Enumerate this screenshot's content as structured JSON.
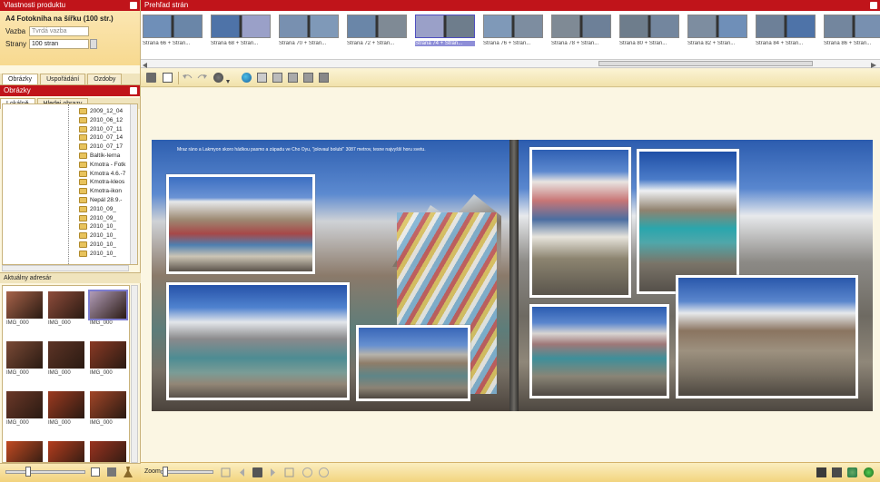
{
  "product_panel": {
    "title": "Vlastnosti produktu",
    "product_name": "A4 Fotokniha na šířku (100 str.)",
    "cover_label": "Vazba",
    "cover_value": "Tvrdá vazba",
    "pages_label": "Strany",
    "pages_value": "100 stran"
  },
  "left_tabs": [
    "Obrázky",
    "Uspořádání",
    "Ozdoby"
  ],
  "images_panel": {
    "title": "Obrázky",
    "tree_tabs": [
      "Lokálně",
      "Hledej obrazy"
    ],
    "folders": [
      "2009_12_04",
      "2010_06_12",
      "2010_07_11",
      "2010_07_14",
      "2010_07_17",
      "Baltík-Ierna",
      "Kmotra - Fotk",
      "Kmotra 4.6.-7",
      "Kmotra-kleos",
      "Kmotra-ikon",
      "Nepál 28.9.-",
      "2010_09_",
      "2010_09_",
      "2010_10_",
      "2010_10_",
      "2010_10_",
      "2010_10_"
    ]
  },
  "recent": {
    "title": "Aktuálny adresár",
    "items": [
      {
        "label": "IMG_000",
        "color": "#a7634a"
      },
      {
        "label": "IMG_000",
        "color": "#8e4c3b"
      },
      {
        "label": "IMG_000",
        "color": "#b19cb8"
      },
      {
        "label": "IMG_000",
        "color": "#7a4a36"
      },
      {
        "label": "IMG_000",
        "color": "#5d3426"
      },
      {
        "label": "IMG_000",
        "color": "#8a3a25"
      },
      {
        "label": "IMG_000",
        "color": "#6b3828"
      },
      {
        "label": "IMG_000",
        "color": "#9c3a20"
      },
      {
        "label": "IMG_000",
        "color": "#a24628"
      },
      {
        "label": "IMG_000",
        "color": "#c24a22"
      },
      {
        "label": "IMG_000",
        "color": "#b53d1e"
      },
      {
        "label": "IMG_000",
        "color": "#9a3320"
      }
    ]
  },
  "page_strip": {
    "title": "Prehľad strán",
    "items": [
      {
        "label": "Strana 66 + Stran...",
        "selected": false
      },
      {
        "label": "Strana 68 + Stran...",
        "selected": false
      },
      {
        "label": "Strana 70 + Stran...",
        "selected": false
      },
      {
        "label": "Strana 72 + Stran...",
        "selected": false
      },
      {
        "label": "Strana 74 + Stran...",
        "selected": true
      },
      {
        "label": "Strana 76 + Stran...",
        "selected": false
      },
      {
        "label": "Strana 78 + Stran...",
        "selected": false
      },
      {
        "label": "Strana 80 + Stran...",
        "selected": false
      },
      {
        "label": "Strana 82 + Stran...",
        "selected": false
      },
      {
        "label": "Strana 84 + Stran...",
        "selected": false
      },
      {
        "label": "Strana 86 + Stran...",
        "selected": false
      }
    ]
  },
  "spread": {
    "caption": "Mraz ráno a Lakmyon skoro hádkou pasmo a západu ve Cho Oyu, \"jolovaul bolubí\" 3087 metrov, tesne najvyšší horu svetu."
  },
  "bottom": {
    "zoom_label": "Zoom"
  },
  "colors": {
    "brand_red": "#c0141a",
    "accent_orange": "#f2d47e"
  }
}
